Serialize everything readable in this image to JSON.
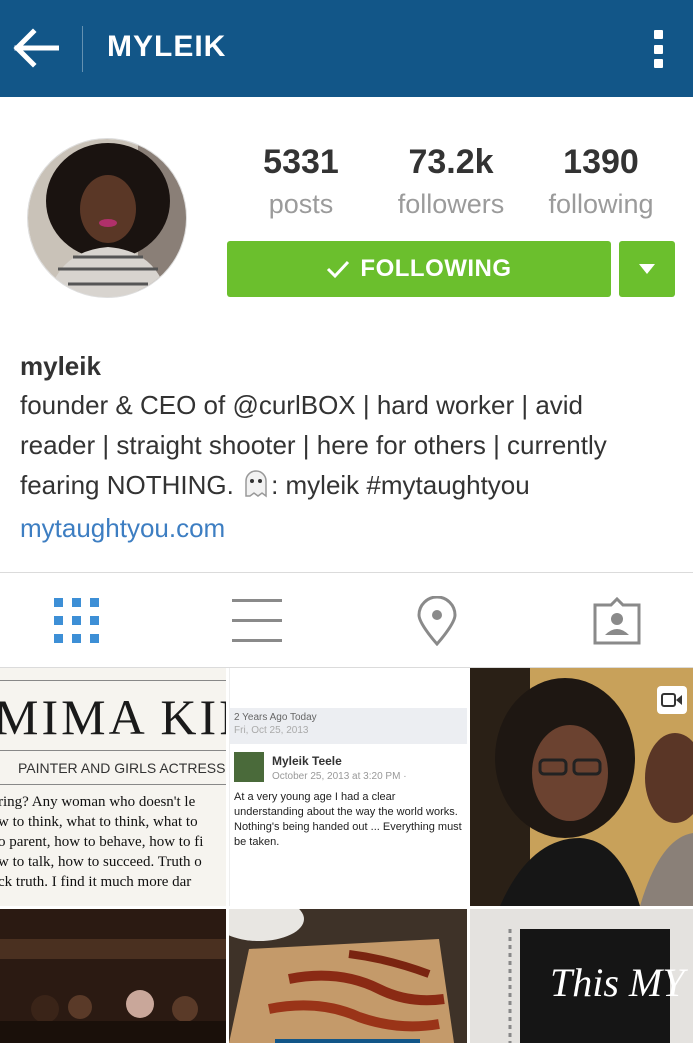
{
  "appbar": {
    "title": "MYLEIK",
    "background": "#125688",
    "back_icon": "arrow-left-icon",
    "menu_icon": "more-vertical-icon"
  },
  "profile": {
    "stats": [
      {
        "value": "5331",
        "label": "posts"
      },
      {
        "value": "73.2k",
        "label": "followers"
      },
      {
        "value": "1390",
        "label": "following"
      }
    ],
    "follow_button": {
      "label": "FOLLOWING",
      "color": "#6bbf2d",
      "icon": "checkmark-icon"
    },
    "dropdown_icon": "caret-down-icon"
  },
  "bio": {
    "username": "myleik",
    "line1": "founder & CEO of @curlBOX | hard worker | avid",
    "line2": "reader | straight shooter | here for others | currently",
    "line3_before": "fearing NOTHING.",
    "line3_after": ": myleik #mytaughtyou",
    "ghost_icon": "ghost-emoji-icon",
    "link": "mytaughtyou.com",
    "link_color": "#3d7ec2"
  },
  "tabs": [
    {
      "name": "grid-view",
      "icon": "grid-icon",
      "active": true
    },
    {
      "name": "list-view",
      "icon": "list-icon",
      "active": false
    },
    {
      "name": "map-view",
      "icon": "location-pin-icon",
      "active": false
    },
    {
      "name": "tagged-view",
      "icon": "tagged-person-icon",
      "active": false
    }
  ],
  "grid": {
    "post1": {
      "headline": "MIMA KIR",
      "subhead": "PAINTER AND GIRLS ACTRESS",
      "body_lines": [
        "ring? Any woman who doesn't le",
        "w to think, what to think, what to",
        "o parent, how to behave, how to fi",
        "w to talk, how to succeed. Truth o",
        "ck truth. I find it much more dar"
      ]
    },
    "post2": {
      "date_line1": "2 Years Ago Today",
      "date_line2": "Fri, Oct 25, 2013",
      "author": "Myleik Teele",
      "timestamp": "October 25, 2013 at 3:20 PM ·",
      "text": "At a very young age I had a clear understanding about the way the world works.  Nothing's being handed out ... Everything must be taken."
    },
    "post6": {
      "text": "This MY"
    }
  }
}
